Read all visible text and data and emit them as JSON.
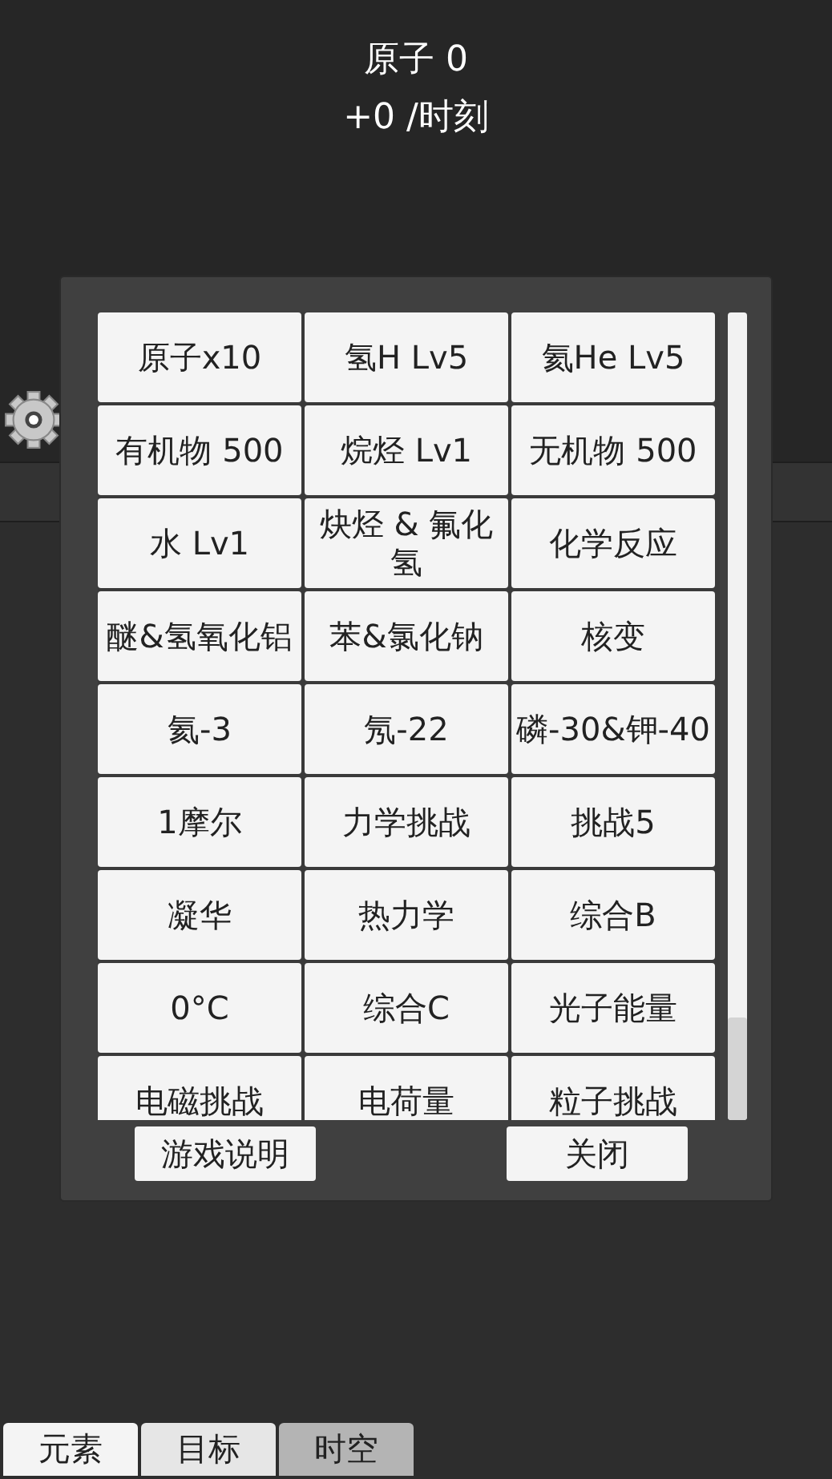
{
  "header": {
    "atoms": "原子 0",
    "rate": "+0 /时刻"
  },
  "dialog": {
    "items": [
      {
        "label": "原子x10"
      },
      {
        "label": "氢H Lv5"
      },
      {
        "label": "氦He Lv5"
      },
      {
        "label": "有机物 500"
      },
      {
        "label": "烷烃 Lv1"
      },
      {
        "label": "无机物 500"
      },
      {
        "label": "水 Lv1"
      },
      {
        "label": "炔烃 & 氟化氢"
      },
      {
        "label": "化学反应"
      },
      {
        "label": "醚&氢氧化铝"
      },
      {
        "label": "苯&氯化钠"
      },
      {
        "label": "核变"
      },
      {
        "label": "氦-3"
      },
      {
        "label": "氖-22"
      },
      {
        "label": "磷-30&钾-40"
      },
      {
        "label": "1摩尔"
      },
      {
        "label": "力学挑战"
      },
      {
        "label": "挑战5"
      },
      {
        "label": "凝华"
      },
      {
        "label": "热力学"
      },
      {
        "label": "综合B"
      },
      {
        "label": "0°C"
      },
      {
        "label": "综合C"
      },
      {
        "label": "光子能量"
      },
      {
        "label": "电磁挑战"
      },
      {
        "label": "电荷量"
      },
      {
        "label": "粒子挑战"
      }
    ],
    "buttons": [
      "游戏说明",
      "关闭"
    ]
  },
  "tabs": [
    {
      "label": "元素",
      "selected": false
    },
    {
      "label": "目标",
      "selected": false
    },
    {
      "label": "时空",
      "selected": true
    }
  ]
}
